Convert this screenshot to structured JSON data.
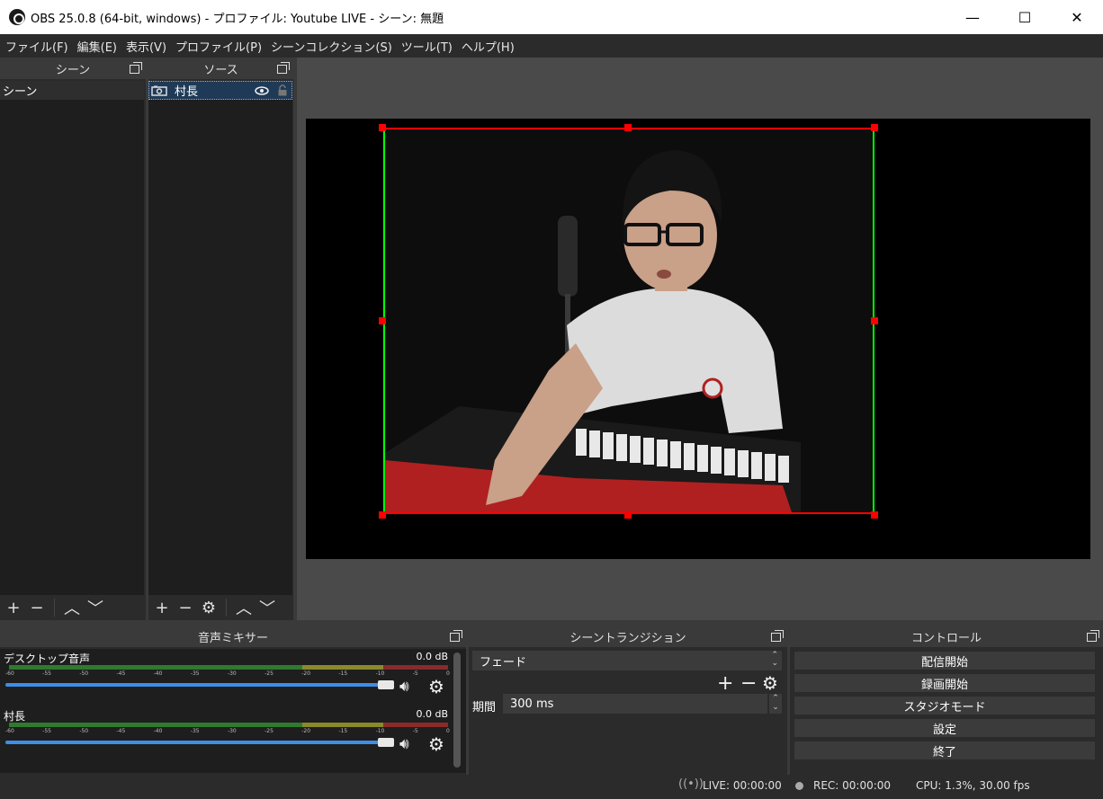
{
  "window": {
    "title": "OBS 25.0.8 (64-bit, windows) - プロファイル: Youtube LIVE - シーン: 無題",
    "minimize": "—",
    "maximize": "☐",
    "close": "✕"
  },
  "menu": [
    "ファイル(F)",
    "編集(E)",
    "表示(V)",
    "プロファイル(P)",
    "シーンコレクション(S)",
    "ツール(T)",
    "ヘルプ(H)"
  ],
  "scenes": {
    "header": "シーン",
    "items": [
      "シーン"
    ]
  },
  "sources": {
    "header": "ソース",
    "items": [
      {
        "name": "村長",
        "icon": "camera-icon",
        "visible": true,
        "locked": false
      }
    ]
  },
  "mixer": {
    "header": "音声ミキサー",
    "ticks": [
      "-60",
      "-55",
      "-50",
      "-45",
      "-40",
      "-35",
      "-30",
      "-25",
      "-20",
      "-15",
      "-10",
      "-5",
      "0"
    ],
    "channels": [
      {
        "name": "デスクトップ音声",
        "db": "0.0 dB"
      },
      {
        "name": "村長",
        "db": "0.0 dB"
      }
    ]
  },
  "transitions": {
    "header": "シーントランジション",
    "selected": "フェード",
    "duration_label": "期間",
    "duration_value": "300 ms"
  },
  "controls": {
    "header": "コントロール",
    "buttons": [
      "配信開始",
      "録画開始",
      "スタジオモード",
      "設定",
      "終了"
    ]
  },
  "status": {
    "live": "LIVE: 00:00:00",
    "rec": "REC: 00:00:00",
    "cpu": "CPU: 1.3%, 30.00 fps"
  },
  "colors": {
    "selection_green": "#00ff00",
    "selection_red": "#ff0000",
    "fader_blue": "#3d8ee8",
    "meter_green": "#2f9a2f",
    "meter_yellow": "#9a9a2f",
    "meter_red": "#9a2f2f"
  }
}
